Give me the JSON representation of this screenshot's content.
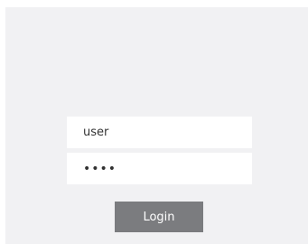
{
  "login": {
    "username_value": "user",
    "password_value": "pass",
    "button_label": "Login"
  },
  "colors": {
    "panel_background": "#f1f1f3",
    "button_background": "#7b7c7f",
    "button_text": "#ffffff"
  }
}
